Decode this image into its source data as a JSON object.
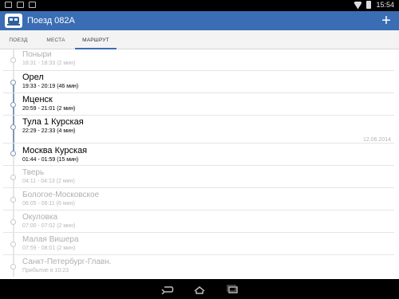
{
  "status_bar": {
    "time": "15:54",
    "icons": [
      "image-notification-icon",
      "mail-icon",
      "lock-icon"
    ]
  },
  "app": {
    "title": "Поезд 082А",
    "add_label": "+"
  },
  "tabs": [
    {
      "label": "ПОЕЗД",
      "active": false
    },
    {
      "label": "МЕСТА",
      "active": false
    },
    {
      "label": "МАРШРУТ",
      "active": true
    }
  ],
  "route": {
    "date_label": "12.06.2014",
    "stops": [
      {
        "name": "Поныри",
        "time": "18:31 - 18:33 (2 мин)",
        "state": "passed"
      },
      {
        "name": "Орел",
        "time": "19:33 - 20:19 (46 мин)",
        "state": "active"
      },
      {
        "name": "Мценск",
        "time": "20:59 - 21:01 (2 мин)",
        "state": "active"
      },
      {
        "name": "Тула 1 Курская",
        "time": "22:29 - 22:33 (4 мин)",
        "state": "active"
      },
      {
        "name": "Москва Курская",
        "time": "01:44 - 01:59 (15 мин)",
        "state": "active"
      },
      {
        "name": "Тверь",
        "time": "04:11 - 04:13 (2 мин)",
        "state": "upcoming"
      },
      {
        "name": "Бологое-Московское",
        "time": "06:05 - 06:11 (6 мин)",
        "state": "upcoming"
      },
      {
        "name": "Окуловка",
        "time": "07:00 - 07:02 (2 мин)",
        "state": "upcoming"
      },
      {
        "name": "Малая Вишера",
        "time": "07:59 - 08:01 (2 мин)",
        "state": "upcoming"
      },
      {
        "name": "Санкт-Петербург-Главн.",
        "time": "Прибытие в 10:23",
        "state": "upcoming"
      }
    ]
  },
  "colors": {
    "accent": "#3a6db3",
    "timeline_active": "#7f98b6",
    "faded_text": "#b0b0b0"
  },
  "nav_bar": {
    "buttons": [
      "back-icon",
      "home-icon",
      "recent-apps-icon"
    ]
  }
}
